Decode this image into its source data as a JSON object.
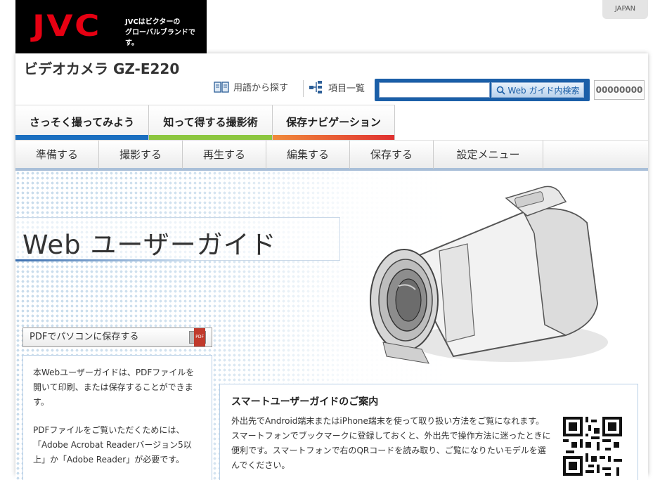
{
  "brand": {
    "logo": "JVC",
    "tagline_line1": "JVCはビクターの",
    "tagline_line2": "グローバルブランドです。"
  },
  "region_button": "JAPAN",
  "product_title": "ビデオカメラ GZ-E220",
  "utilities": {
    "glossary_label": "用語から探す",
    "index_label": "項目一覧",
    "search_placeholder": "",
    "search_button_label": "Web ガイド内検索",
    "counter": "00000000"
  },
  "category_tabs": [
    {
      "label": "さっそく撮ってみよう",
      "color": "#1b6fc0"
    },
    {
      "label": "知って得する撮影術",
      "color": "#8cc63f"
    },
    {
      "label": "保存ナビゲーション",
      "color": "#e03030"
    }
  ],
  "sub_menu": [
    "準備する",
    "撮影する",
    "再生する",
    "編集する",
    "保存する",
    "設定メニュー"
  ],
  "hero": {
    "title": "Web ユーザーガイド"
  },
  "pdf_button": "PDFでパソコンに保存する",
  "pdf_icon_label": "PDF",
  "info_left": {
    "paragraph1": "本Webユーザーガイドは、PDFファイルを開いて印刷、または保存することができます。",
    "paragraph2": "PDFファイルをご覧いただくためには、「Adobe Acrobat Readerバージョン5以上」か「Adobe Reader」が必要です。"
  },
  "smart_guide": {
    "title": "スマートユーザーガイドのご案内",
    "text": "外出先でAndroid端末またはiPhone端末を使って取り扱い方法をご覧になれます。スマートフォンでブックマークに登録しておくと、外出先で操作方法に迷ったときに便利です。スマートフォンで右のQRコードを読み取り、ご覧になりたいモデルを選んでください。"
  }
}
